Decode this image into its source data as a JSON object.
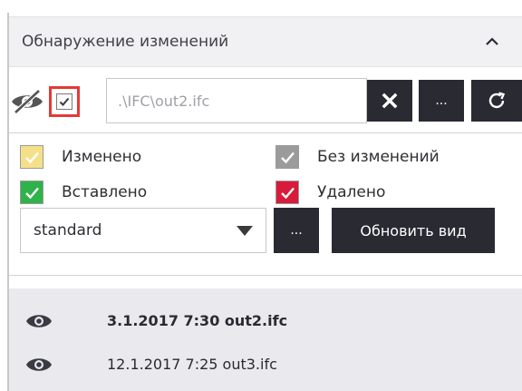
{
  "panel": {
    "title": "Обнаружение изменений"
  },
  "source": {
    "path_value": ".\\IFC\\out2.ifc",
    "browse_label": "..."
  },
  "legend": {
    "items": [
      {
        "label": "Изменено",
        "color": "#f5e08a"
      },
      {
        "label": "Без изменений",
        "color": "#9b9b9b"
      },
      {
        "label": "Вставлено",
        "color": "#2fb24a"
      },
      {
        "label": "Удалено",
        "color": "#d81b3a"
      }
    ]
  },
  "style_row": {
    "selected_style": "standard",
    "browse_label": "...",
    "update_label": "Обновить вид"
  },
  "versions": [
    {
      "label": "3.1.2017 7:30 out2.ifc",
      "bold": true
    },
    {
      "label": "12.1.2017 7:25 out3.ifc",
      "bold": false
    }
  ],
  "colors": {
    "dark_button": "#2a2a33",
    "header_bg": "#f1f1f3",
    "list_bg": "#e9e9ee",
    "highlight_border": "#e53935"
  },
  "icons": {
    "collapse": "chevron-up-icon",
    "visibility_toggle": "eye-off-icon",
    "clear": "close-icon",
    "refresh": "refresh-icon",
    "dropdown": "caret-down-icon",
    "version_visibility": "eye-icon"
  }
}
